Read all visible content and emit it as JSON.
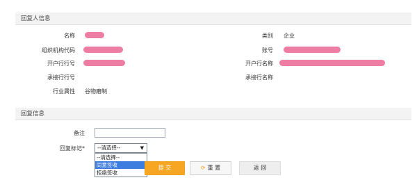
{
  "reply_person": {
    "section_title": "回复人信息",
    "fields": {
      "name_label": "名称",
      "category_label": "类别",
      "category_value": "企业",
      "org_code_label": "组织机构代码",
      "account_label": "账号",
      "bank_no_label": "开户行行号",
      "bank_name_label": "开户行名称",
      "accept_bank_no_label": "承接行行号",
      "accept_bank_name_label": "承接行名称",
      "industry_label": "行业属性",
      "industry_value": "谷物磨制"
    }
  },
  "reply_info": {
    "section_title": "回复信息",
    "remark_label": "备注",
    "remark_value": "",
    "flag_label": "回复标记",
    "required_mark": "*",
    "flag_selected": "--请选择--",
    "flag_options": [
      "--请选择--",
      "同意签收",
      "拒绝签收"
    ],
    "highlighted_option": "同意签收"
  },
  "buttons": {
    "submit": "提 交",
    "reset": "重 置",
    "back": "返 回"
  },
  "icons": {
    "reset_icon": "refresh-icon",
    "select_arrow": "caret-down-icon"
  }
}
